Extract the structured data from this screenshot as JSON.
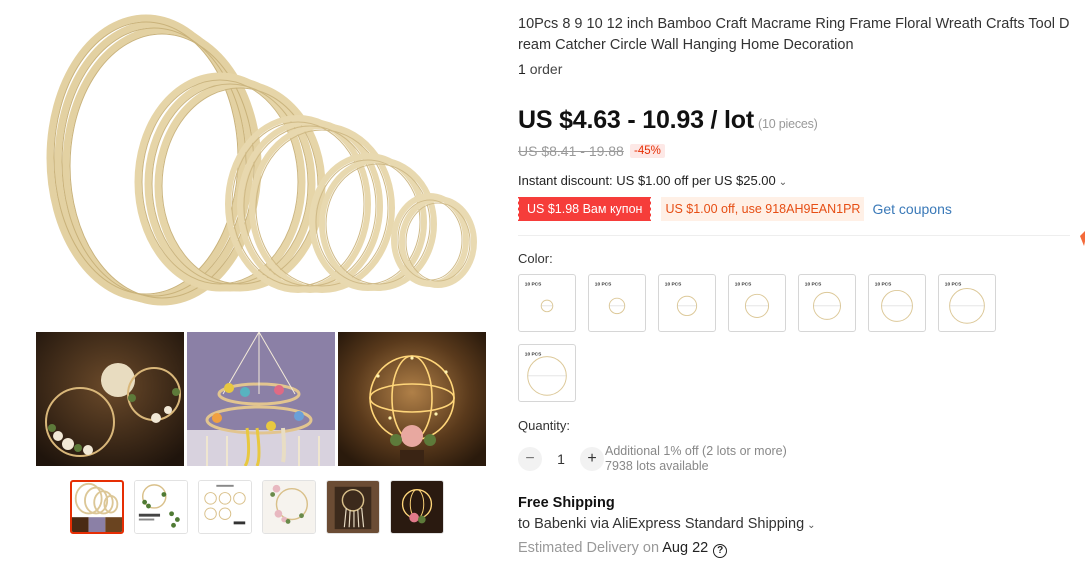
{
  "product": {
    "title": "10Pcs 8 9 10 12 inch Bamboo Craft Macrame Ring Frame Floral Wreath Crafts Tool D ream Catcher Circle Wall Hanging Home Decoration",
    "orders_count": "1",
    "orders_label": "order"
  },
  "gallery": {
    "hero_icon": "bamboo-rings-image",
    "collage": [
      "floral-wreath-hoops-photo",
      "macrame-mobile-photo",
      "lighted-sphere-photo"
    ],
    "thumbnails": [
      "rings-thumb",
      "greenery-wreath-thumb",
      "size-chart-thumb",
      "floral-hoop-thumb",
      "macrame-wall-thumb",
      "lighted-hoop-thumb"
    ],
    "selected_index": 0
  },
  "price": {
    "current": "US $4.63 - 10.93 / lot",
    "unit_note": "(10 pieces)",
    "original": "US $8.41 - 19.88",
    "discount": "-45%"
  },
  "instant_discount": {
    "text": "Instant discount: US $1.00 off per US $25.00"
  },
  "coupons": {
    "red_coupon": "US $1.98 Вам купон",
    "code_coupon": "US $1.00 off, use 918AH9EAN1PR",
    "get_coupons": "Get coupons"
  },
  "color": {
    "label": "Color:",
    "options": [
      "10 PCS",
      "10 PCS",
      "10 PCS",
      "10 PCS",
      "10 PCS",
      "10 PCS",
      "10 PCS",
      "10 PCS"
    ]
  },
  "quantity": {
    "label": "Quantity:",
    "minus": "−",
    "value": "1",
    "plus": "+",
    "note_line1": "Additional 1% off (2 lots or more)",
    "note_line2": "7938 lots available"
  },
  "shipping": {
    "title": "Free Shipping",
    "line": "to Babenki via AliExpress Standard Shipping",
    "delivery_label": "Estimated Delivery on",
    "delivery_date": "Aug 22",
    "help": "?"
  },
  "colors": {
    "accent_red": "#e62e04",
    "coupon_red": "#f63d3a",
    "link_blue": "#3a79b8",
    "bamboo": "#e0cc9a"
  }
}
